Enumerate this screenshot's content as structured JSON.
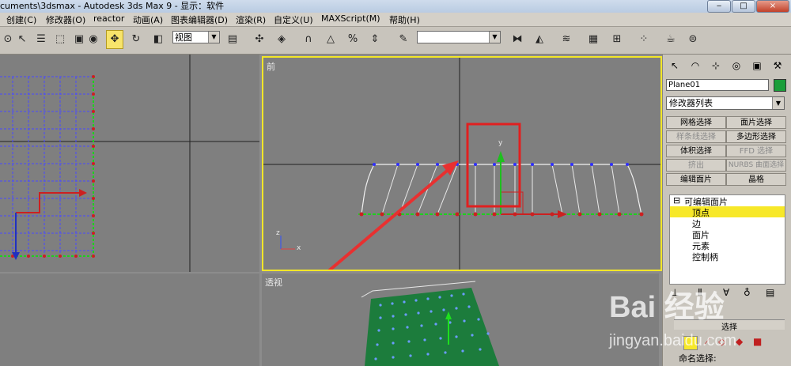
{
  "window": {
    "title": "cuments\\3dsmax      - Autodesk 3ds Max 9      - 显示：软件",
    "btn_min": "‒",
    "btn_max": "□",
    "btn_close": "×"
  },
  "menu": [
    "创建(C)",
    "修改器(O)",
    "reactor",
    "动画(A)",
    "图表编辑器(D)",
    "渲染(R)",
    "自定义(U)",
    "MAXScript(M)",
    "帮助(H)"
  ],
  "toolbar": {
    "view_combo": "视图",
    "named_selection_combo": ""
  },
  "viewports": {
    "front_label": "前",
    "perspective_label": "透视",
    "axis_y": "y",
    "axis_z": "z",
    "axis_x": "x"
  },
  "panel": {
    "object_name": "Plane01",
    "object_color": "#1a9e3a",
    "modifier_list": "修改器列表",
    "buttons": {
      "mesh_select": "网格选择",
      "patch_select": "面片选择",
      "spline_select": "样条线选择",
      "poly_select": "多边形选择",
      "vol_select": "体积选择",
      "ffd_select": "FFD 选择",
      "extrude": "挤出",
      "nurbs_select": "NURBS 曲面选择",
      "edit_patch": "编辑面片",
      "lattice": "晶格"
    },
    "stack": {
      "root": "可编辑面片",
      "items": [
        "顶点",
        "边",
        "面片",
        "元素",
        "控制柄"
      ]
    },
    "rollout_selection": "选择",
    "named_selections": "命名选择:"
  },
  "watermark": {
    "logo": "Bai 经验",
    "url": "jingyan.baidu.com"
  }
}
